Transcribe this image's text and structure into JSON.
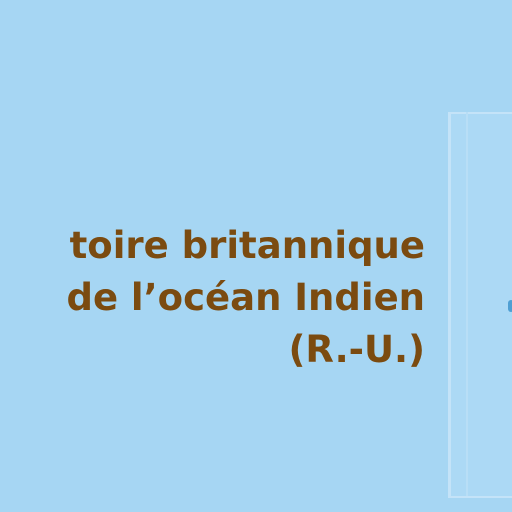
{
  "map": {
    "label_lines": [
      "toire britannique",
      "de l’océan Indien",
      "(R.-U.)"
    ]
  },
  "colors": {
    "sea": "#a6d6f3",
    "label": "#7b4b10",
    "inset_border": "#c4e3f8",
    "marker": "#4f9fd3"
  }
}
